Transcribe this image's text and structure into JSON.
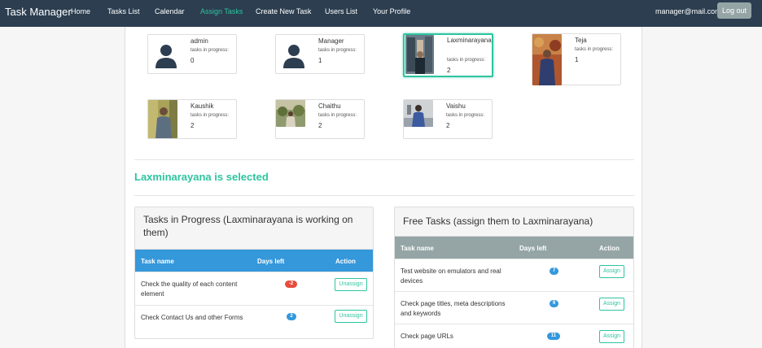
{
  "navbar": {
    "brand": "Task Manager",
    "links": [
      "Home",
      "Tasks List",
      "Calendar",
      "Assign Tasks",
      "Create New Task",
      "Users List",
      "Your Profile"
    ],
    "active": "Assign Tasks",
    "email": "manager@mail.com",
    "logout": "Log out"
  },
  "users": [
    {
      "name": "admin",
      "sub": "tasks in progress:",
      "count": "0",
      "avatar": "default-user-icon"
    },
    {
      "name": "Manager",
      "sub": "tasks in progress:",
      "count": "1",
      "avatar": "default-user-icon"
    },
    {
      "name": "Laxminarayana",
      "sub": "tasks in progress:",
      "count": "2",
      "avatar": "photo",
      "selected": true
    },
    {
      "name": "Teja",
      "sub": "tasks in progress:",
      "count": "1",
      "avatar": "photo"
    },
    {
      "name": "Kaushik",
      "sub": "tasks in progress:",
      "count": "2",
      "avatar": "photo"
    },
    {
      "name": "Chaithu",
      "sub": "tasks in progress:",
      "count": "2",
      "avatar": "photo"
    },
    {
      "name": "Vaishu",
      "sub": "tasks in progress:",
      "count": "2",
      "avatar": "photo"
    }
  ],
  "selected_heading": "Laxminarayana is selected",
  "in_progress": {
    "title": "Tasks in Progress (Laxminarayana is working on them)",
    "columns": [
      "Task name",
      "Days left",
      "Action"
    ],
    "rows": [
      {
        "task": "Check the quality of each content element",
        "days": "-2",
        "action": "Unassign"
      },
      {
        "task": "Check Contact Us and other Forms",
        "days": "2",
        "action": "Unassign"
      }
    ]
  },
  "free": {
    "title": "Free Tasks (assign them to Laxminarayana)",
    "columns": [
      "Task name",
      "Days left",
      "Action"
    ],
    "rows": [
      {
        "task": "Test website on emulators and real devices",
        "days": "7",
        "action": "Assign"
      },
      {
        "task": "Check page titles, meta descriptions and keywords",
        "days": "9",
        "action": "Assign"
      },
      {
        "task": "Check page URLs",
        "days": "11",
        "action": "Assign"
      }
    ]
  },
  "colors": {
    "accent": "#2ec4a0",
    "navbar": "#2c3e50",
    "progress_header": "#3498db",
    "free_header": "#95a5a6",
    "badge_red": "#e74c3c",
    "badge_blue": "#3498db"
  }
}
